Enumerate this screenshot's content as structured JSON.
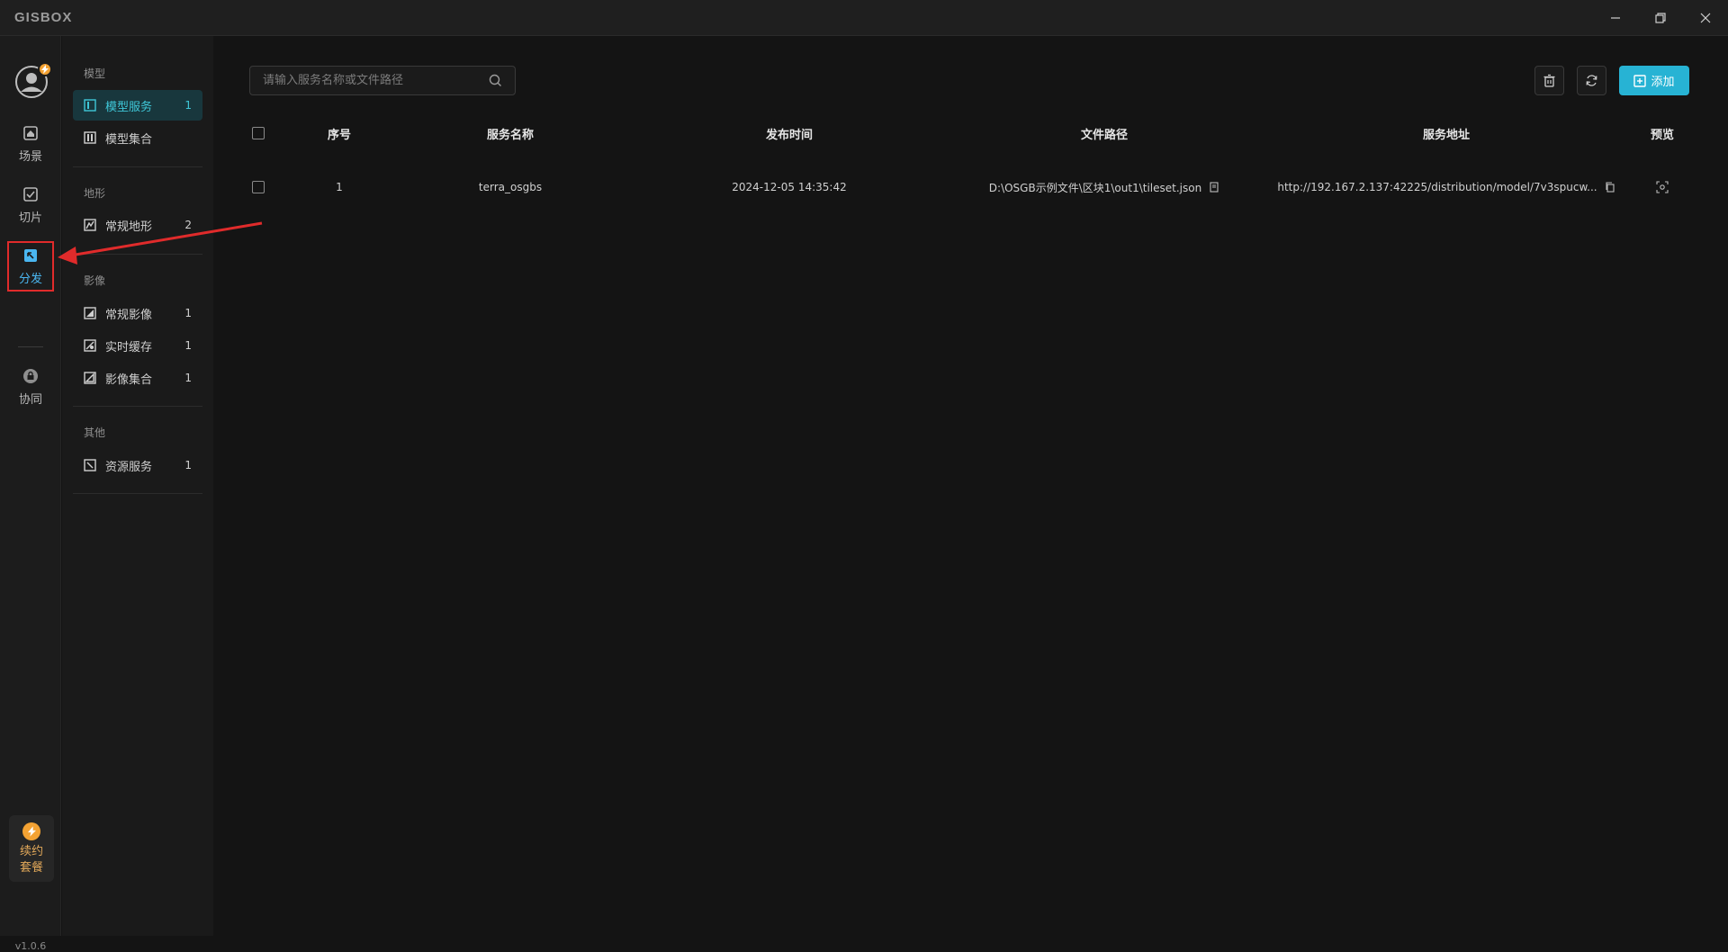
{
  "app": {
    "logo": "GISBOX",
    "version": "v1.0.6"
  },
  "rail": {
    "items": [
      {
        "label": "场景",
        "icon": "home-icon"
      },
      {
        "label": "切片",
        "icon": "slice-icon"
      },
      {
        "label": "分发",
        "icon": "distribute-icon"
      },
      {
        "label": "协同",
        "icon": "lock-icon"
      }
    ],
    "active": "分发",
    "renew_label_1": "续约",
    "renew_label_2": "套餐"
  },
  "sidebar": {
    "sections": [
      {
        "title": "模型",
        "items": [
          {
            "label": "模型服务",
            "count": "1"
          },
          {
            "label": "模型集合",
            "count": ""
          }
        ]
      },
      {
        "title": "地形",
        "items": [
          {
            "label": "常规地形",
            "count": "2"
          }
        ]
      },
      {
        "title": "影像",
        "items": [
          {
            "label": "常规影像",
            "count": "1"
          },
          {
            "label": "实时缓存",
            "count": "1"
          },
          {
            "label": "影像集合",
            "count": "1"
          }
        ]
      },
      {
        "title": "其他",
        "items": [
          {
            "label": "资源服务",
            "count": "1"
          }
        ]
      }
    ],
    "active_item": "模型服务"
  },
  "toolbar": {
    "search_placeholder": "请输入服务名称或文件路径",
    "add_label": "添加"
  },
  "table": {
    "headers": [
      "序号",
      "服务名称",
      "发布时间",
      "文件路径",
      "服务地址",
      "预览"
    ],
    "rows": [
      {
        "index": "1",
        "name": "terra_osgbs",
        "time": "2024-12-05 14:35:42",
        "path": "D:\\OSGB示例文件\\区块1\\out1\\tileset.json",
        "url": "http://192.167.2.137:42225/distribution/model/7v3spucw..."
      }
    ]
  },
  "colors": {
    "accent": "#27b3d4",
    "active_bg": "#18373d",
    "annotation": "#e02b2b",
    "renew": "#f3a233"
  }
}
